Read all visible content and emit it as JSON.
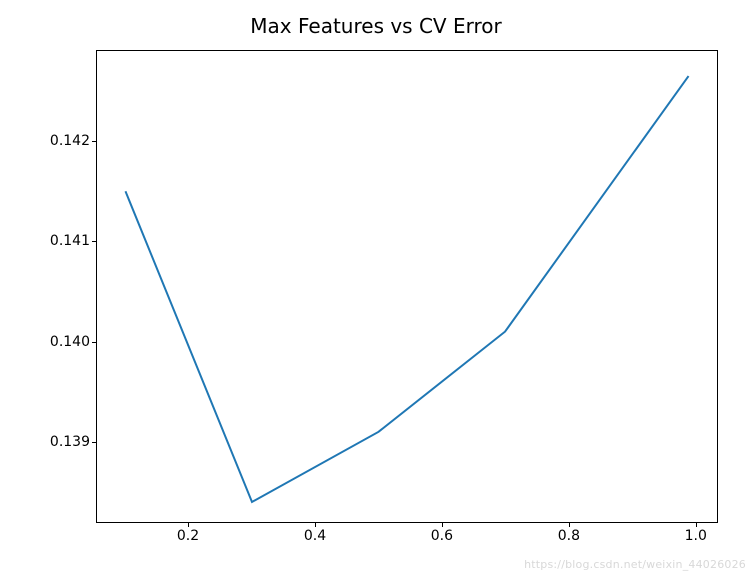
{
  "chart_data": {
    "type": "line",
    "title": "Max Features vs CV Error",
    "xlabel": "",
    "ylabel": "",
    "x": [
      0.1,
      0.3,
      0.5,
      0.7,
      0.99
    ],
    "y": [
      0.1415,
      0.1384,
      0.1391,
      0.1401,
      0.14265
    ],
    "x_ticks": [
      0.2,
      0.4,
      0.6,
      0.8,
      1.0
    ],
    "y_ticks": [
      0.139,
      0.14,
      0.141,
      0.142
    ],
    "xlim": [
      0.055,
      1.035
    ],
    "ylim": [
      0.1382,
      0.1429
    ],
    "line_color": "#1f77b4"
  },
  "watermark": "https://blog.csdn.net/weixin_44026026"
}
